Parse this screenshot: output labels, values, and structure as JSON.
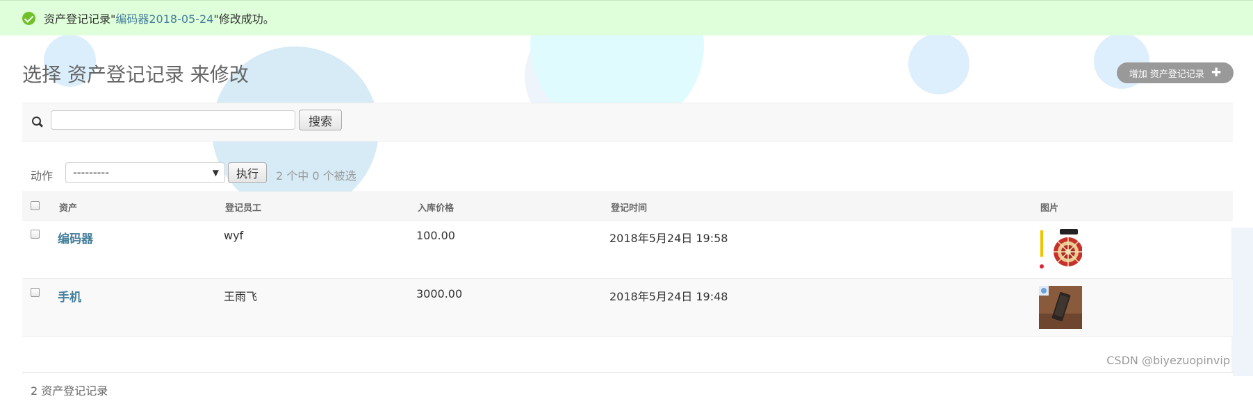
{
  "message": {
    "prefix": "资产登记记录\"",
    "link": "编码器2018-05-24",
    "suffix": "\"修改成功。"
  },
  "header": {
    "title": "选择 资产登记记录 来修改",
    "add_label": "增加 资产登记记录",
    "add_icon": "plus-icon"
  },
  "search": {
    "value": "",
    "placeholder": "",
    "button_label": "搜索",
    "icon": "search-icon"
  },
  "actions": {
    "label": "动作",
    "selected": "---------",
    "go_label": "执行",
    "counter": "2 个中 0 个被选"
  },
  "table": {
    "columns": [
      "资产",
      "登记员工",
      "入库价格",
      "登记时间",
      "图片"
    ],
    "rows": [
      {
        "asset": "编码器",
        "employee": "wyf",
        "price": "100.00",
        "time": "2018年5月24日 19:58",
        "image": "wheel-poster-thumbnail"
      },
      {
        "asset": "手机",
        "employee": "王雨飞",
        "price": "3000.00",
        "time": "2018年5月24日 19:48",
        "image": "phone-photo-thumbnail"
      }
    ]
  },
  "footer": {
    "count": "2 资产登记记录"
  },
  "watermark": "CSDN @biyezuopinvip",
  "colors": {
    "success_bg": "#dfffda",
    "link": "#447e9b",
    "add_button": "#999999",
    "toolbar_bg": "#f8f8f8"
  }
}
